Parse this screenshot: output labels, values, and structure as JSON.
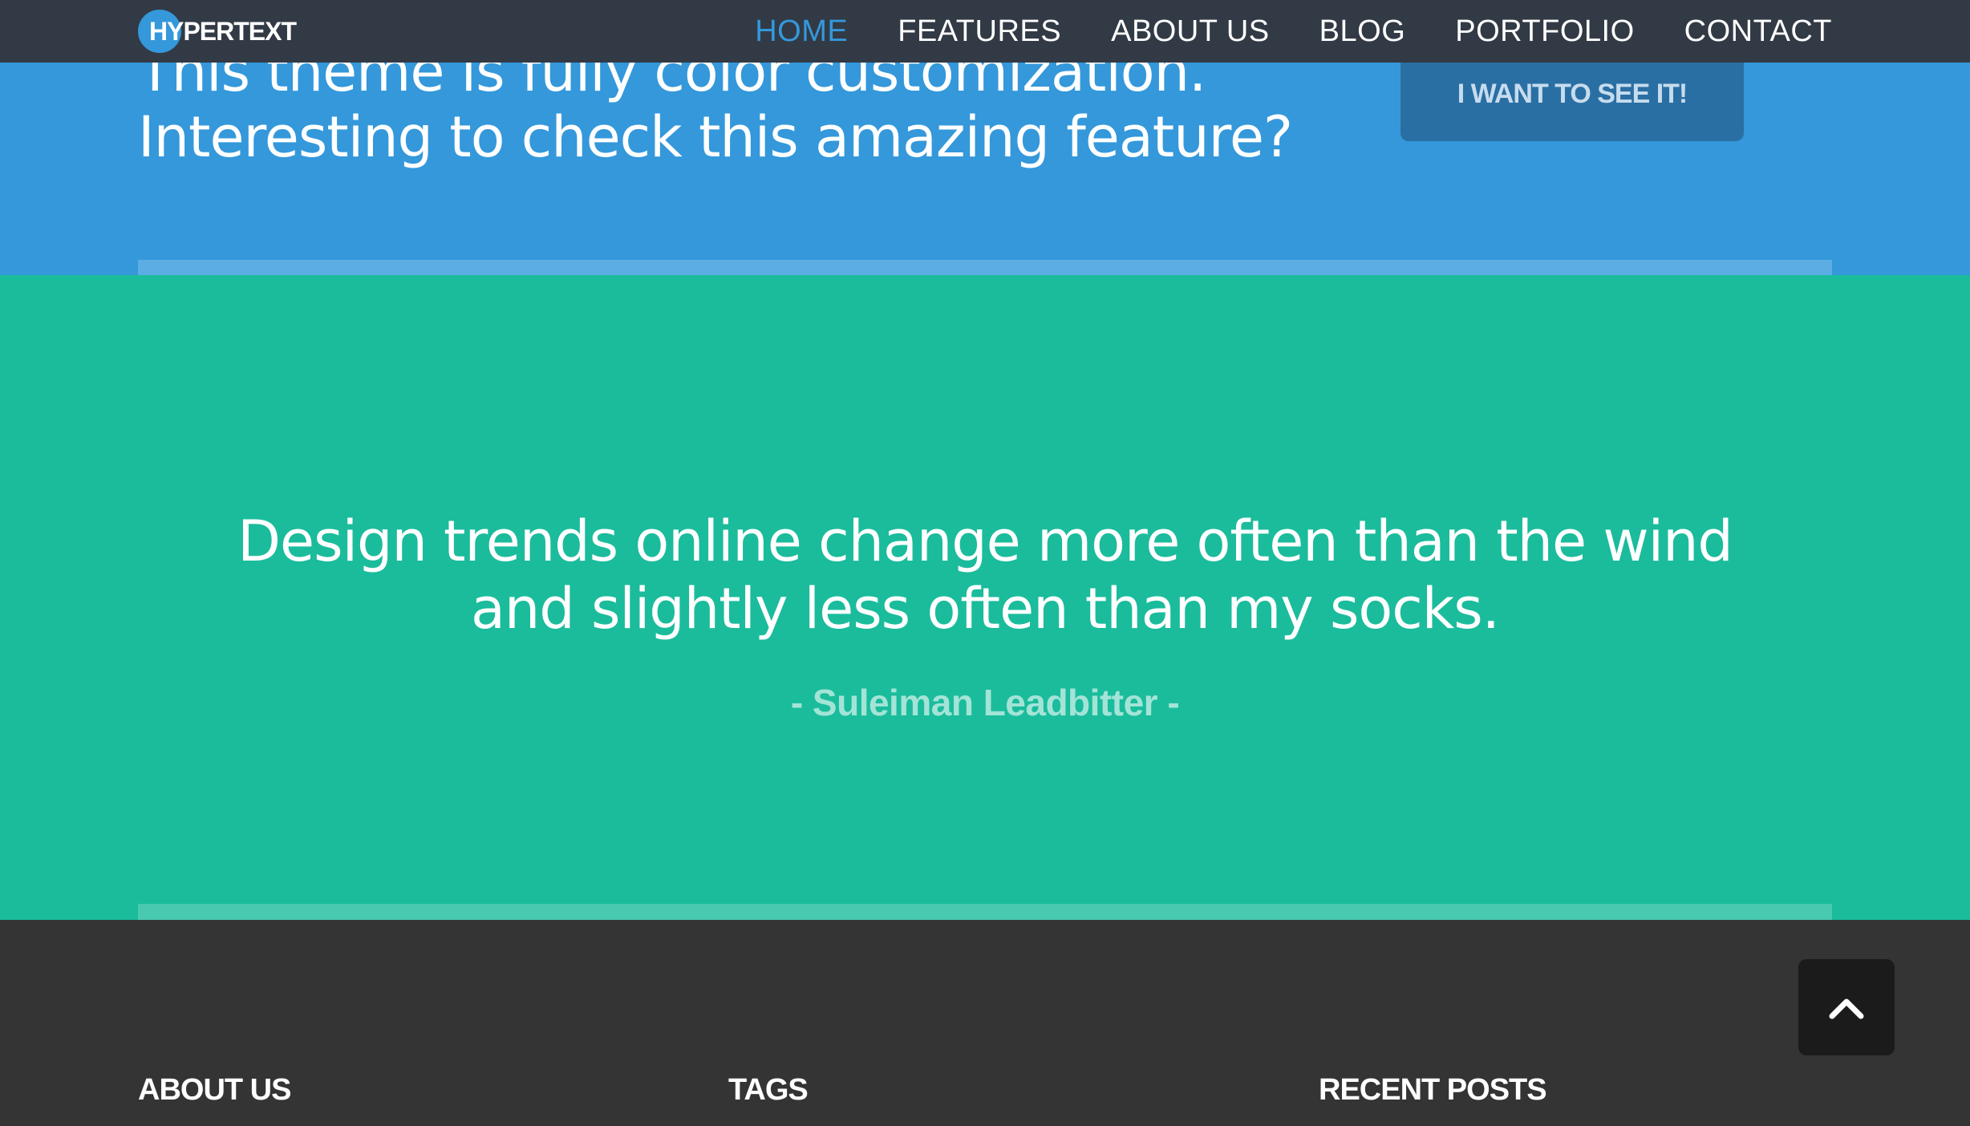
{
  "brand": {
    "logo_text": "HYPERTEXT",
    "accent": "#3498db"
  },
  "nav": {
    "items": [
      "HOME",
      "FEATURES",
      "ABOUT US",
      "BLOG",
      "PORTFOLIO",
      "CONTACT"
    ],
    "active": "HOME"
  },
  "cta": {
    "line1": "This theme is fully color customization.",
    "line2": "Interesting to check this amazing feature?",
    "button_label": "I WANT TO SEE IT!",
    "background": "#3498db"
  },
  "quote": {
    "line1": "Design trends online change more often than the wind",
    "line2": "and slightly less often than my socks.",
    "author": "- Suleiman Leadbitter -",
    "background": "#1abc9c"
  },
  "footer": {
    "col1_title": "ABOUT US",
    "col2_title": "TAGS",
    "col3_title": "RECENT POSTS",
    "background": "#343434"
  },
  "scroll_top": {
    "icon": "chevron-up-icon"
  }
}
